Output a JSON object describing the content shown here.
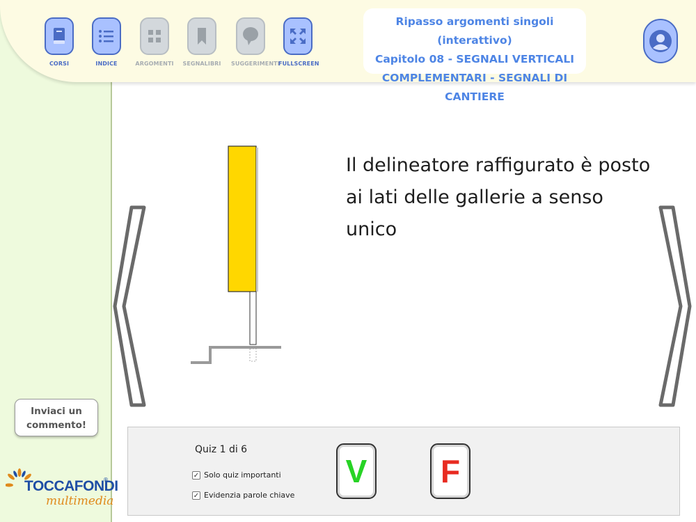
{
  "nav": {
    "items": [
      {
        "label": "CORSI",
        "icon": "book-icon",
        "state": "active"
      },
      {
        "label": "INDICE",
        "icon": "list-icon",
        "state": "active"
      },
      {
        "label": "ARGOMENTI",
        "icon": "grid-icon",
        "state": "disabled"
      },
      {
        "label": "SEGNALIBRI",
        "icon": "bookmark-icon",
        "state": "disabled"
      },
      {
        "label": "SUGGERIMENTI",
        "icon": "speech-bubble-icon",
        "state": "disabled"
      },
      {
        "label": "FULLSCREEN",
        "icon": "fullscreen-icon",
        "state": "active"
      }
    ]
  },
  "chapter": {
    "line1": "Ripasso argomenti singoli (interattivo)",
    "line2": "Capitolo 08 - SEGNALI VERTICALI",
    "line3": "COMPLEMENTARI - SEGNALI DI CANTIERE"
  },
  "user": {
    "icon": "user-avatar-icon"
  },
  "question": {
    "text": "Il delineatore raffigurato è posto ai lati delle gallerie a senso unico"
  },
  "sidebar": {
    "comment_button": "Inviaci un commento!",
    "logo_top": "TOCCAFONDI",
    "logo_bottom": "multimedia",
    "logo_reg": "®"
  },
  "quiz": {
    "counter": "Quiz 1 di 6",
    "options": [
      {
        "label": "Solo quiz importanti",
        "checked": true
      },
      {
        "label": "Evidenzia parole chiave",
        "checked": true
      }
    ],
    "answer_true": "V",
    "answer_false": "F"
  },
  "colors": {
    "accent": "#4a6cc5",
    "chapter_text": "#4e85e5",
    "sidebar_bg": "#eefadd",
    "header_bg": "#fdfbe3",
    "true": "#27d325",
    "false": "#e82a20",
    "delineator": "#ffd700"
  }
}
